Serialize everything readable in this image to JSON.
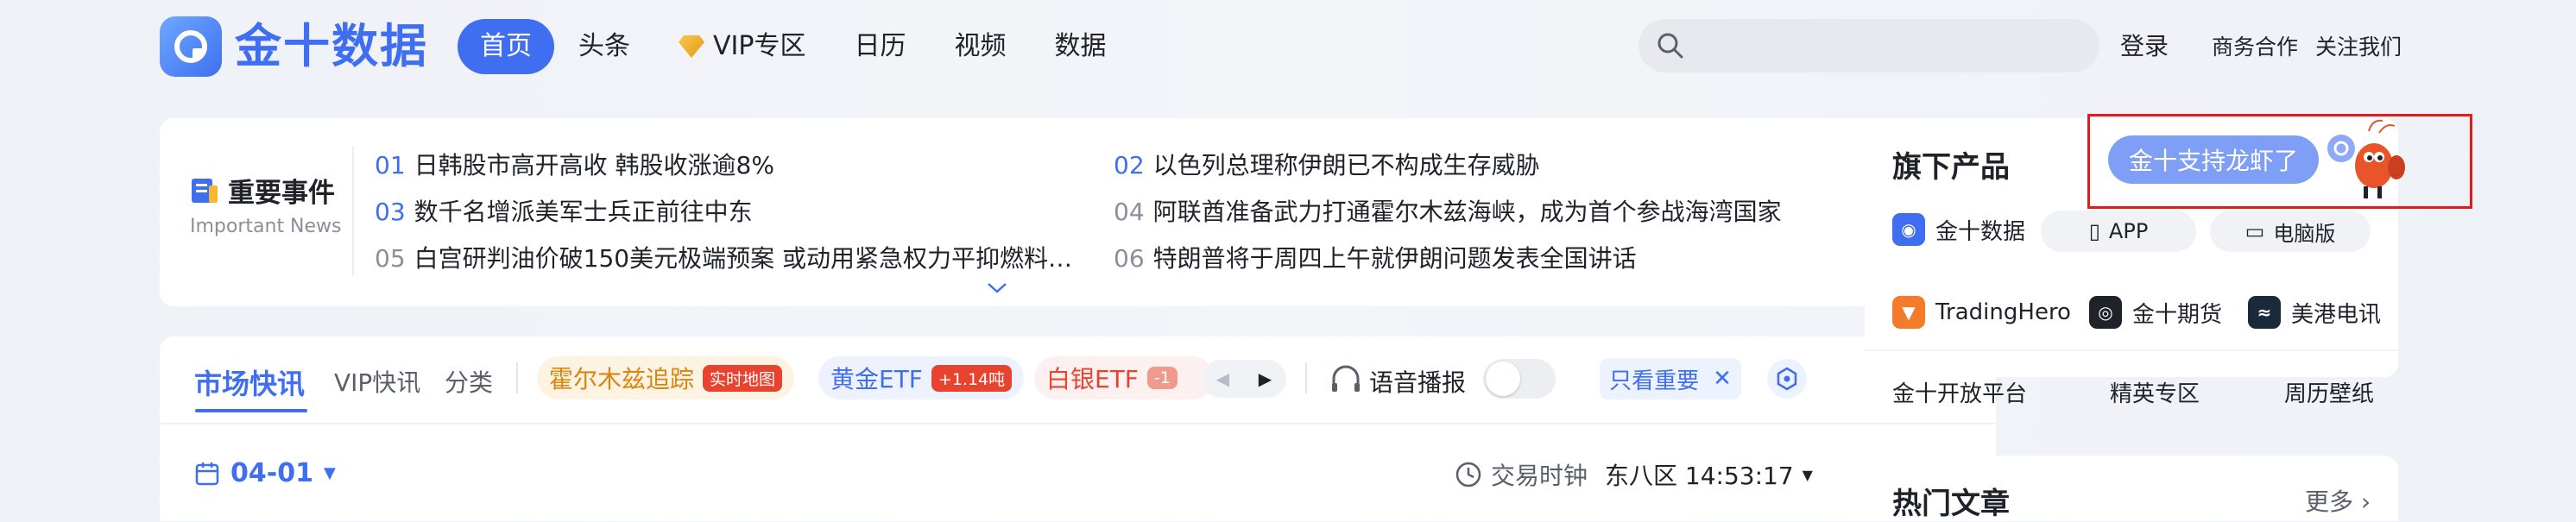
{
  "header": {
    "logo_text": "金十数据",
    "nav": [
      {
        "label": "首页",
        "active": true
      },
      {
        "label": "头条"
      },
      {
        "label": "VIP专区",
        "icon": "vip-diamond-icon"
      },
      {
        "label": "日历"
      },
      {
        "label": "视频"
      },
      {
        "label": "数据"
      }
    ],
    "search_placeholder": "",
    "login": "登录",
    "business": "商务合作",
    "follow": "关注我们"
  },
  "important_news": {
    "title": "重要事件",
    "subtitle": "Important News",
    "items": [
      {
        "num": "01",
        "text": "日韩股市高开高收 韩股收涨逾8%",
        "highlight": true
      },
      {
        "num": "02",
        "text": "以色列总理称伊朗已不构成生存威胁",
        "highlight": true
      },
      {
        "num": "03",
        "text": "数千名增派美军士兵正前往中东",
        "highlight": true
      },
      {
        "num": "04",
        "text": "阿联酋准备武力打通霍尔木兹海峡，成为首个参战海湾国家",
        "highlight": false
      },
      {
        "num": "05",
        "text": "白宫研判油价破150美元极端预案 或动用紧急权力平抑燃料…",
        "highlight": false
      },
      {
        "num": "06",
        "text": "特朗普将于周四上午就伊朗问题发表全国讲话",
        "highlight": false
      }
    ],
    "expand_icon": "chevron-down-icon"
  },
  "flash": {
    "tabs": [
      "市场快讯",
      "VIP快讯",
      "分类"
    ],
    "pills": [
      {
        "label": "霍尔木兹追踪",
        "tag": "实时地图",
        "bg": "#fdf3e2",
        "color": "#d9860f",
        "tag_bg": "#e8432e"
      },
      {
        "label": "黄金ETF",
        "tag": "+1.14吨",
        "bg": "#eef2ff",
        "color": "#3f6ff0",
        "tag_bg": "#e8432e"
      },
      {
        "label": "白银ETF",
        "tag": "-1",
        "bg": "#fdf0f0",
        "color": "#e8432e",
        "tag_bg": "#f09a8e"
      }
    ],
    "audio_label": "语音播报",
    "filter_label": "只看重要",
    "date": "04-01",
    "clock_label": "交易时钟",
    "timezone_time": "东八区 14:53:17"
  },
  "products": {
    "title": "旗下产品",
    "mascot_text": "金十支持龙虾了",
    "row1": {
      "name": "金十数据",
      "app": "APP",
      "pc": "电脑版"
    },
    "row2": [
      {
        "name": "TradingHero",
        "color": "#f47b2a"
      },
      {
        "name": "金十期货",
        "color": "#1f2329"
      },
      {
        "name": "美港电讯",
        "color": "#1a2a3a"
      }
    ],
    "links": [
      "金十开放平台",
      "精英专区",
      "周历壁纸"
    ]
  },
  "hot": {
    "title": "热门文章",
    "more": "更多 ›"
  }
}
